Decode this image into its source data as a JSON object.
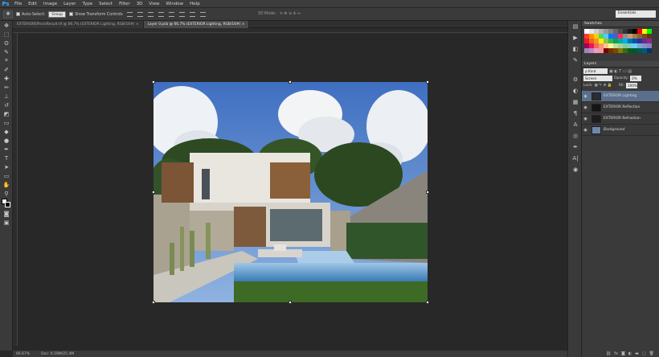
{
  "app": {
    "logo": "Ps"
  },
  "menu": [
    "File",
    "Edit",
    "Image",
    "Layer",
    "Type",
    "Select",
    "Filter",
    "3D",
    "View",
    "Window",
    "Help"
  ],
  "options": {
    "auto_select_label": "Auto-Select:",
    "auto_select_value": "Group",
    "transform_label": "Show Transform Controls",
    "mode_3d_label": "3D Mode:",
    "workspace": "Essentials"
  },
  "tabs": [
    {
      "label": "EXTERIOREffectsResult.tif @ 66.7% (EXTERIOR Lighting, RGB/16#)"
    },
    {
      "label": "Layer 0.psb @ 66.7% (EXTERIOR Lighting, RGB/16#)"
    }
  ],
  "status": {
    "zoom": "66.67%",
    "doc": "Doc: 6.59M/25.4M"
  },
  "panels": {
    "swatches_title": "Swatches",
    "layers_title": "Layers",
    "kind_label": "Kind",
    "blend_mode": "Screen",
    "opacity_label": "Opacity:",
    "opacity_value": "3%",
    "lock_label": "Lock:",
    "fill_label": "Fill:",
    "fill_value": "100%"
  },
  "layers": [
    {
      "name": "EXTERIOR Lighting",
      "selected": true
    },
    {
      "name": "EXTERIOR Reflection",
      "selected": false
    },
    {
      "name": "EXTERIOR Refraction",
      "selected": false
    },
    {
      "name": "Background",
      "selected": false
    }
  ],
  "colors": {
    "swatches": [
      "#ffffff",
      "#e6e6e6",
      "#cccccc",
      "#b3b3b3",
      "#999999",
      "#808080",
      "#666666",
      "#4d4d4d",
      "#333333",
      "#1a1a1a",
      "#000000",
      "#ff0000",
      "#ffff00",
      "#00ff00",
      "#ff3b30",
      "#ff9500",
      "#ffcc00",
      "#4cd964",
      "#5ac8fa",
      "#007aff",
      "#5856d6",
      "#ff2d55",
      "#8e8e93",
      "#c69c6d",
      "#a67c52",
      "#8c6239",
      "#754c24",
      "#603913",
      "#ed1c24",
      "#f26522",
      "#f7941d",
      "#fff200",
      "#8dc63f",
      "#39b54a",
      "#00a651",
      "#00a99d",
      "#00aeef",
      "#0072bc",
      "#0054a6",
      "#2e3192",
      "#662d91",
      "#92278f",
      "#9e005d",
      "#ed145b",
      "#f26c4f",
      "#f69679",
      "#fdc689",
      "#fff799",
      "#c4df9b",
      "#a3d39c",
      "#82ca9c",
      "#7accc8",
      "#6dcff6",
      "#7da7d9",
      "#8393ca",
      "#8781bd",
      "#a186be",
      "#bd8cbf",
      "#f49ac2",
      "#f5989d",
      "#790000",
      "#7b2e00",
      "#7d4900",
      "#827b00",
      "#406618",
      "#005e20",
      "#005826",
      "#005952",
      "#005b7f",
      "#003663"
    ]
  }
}
